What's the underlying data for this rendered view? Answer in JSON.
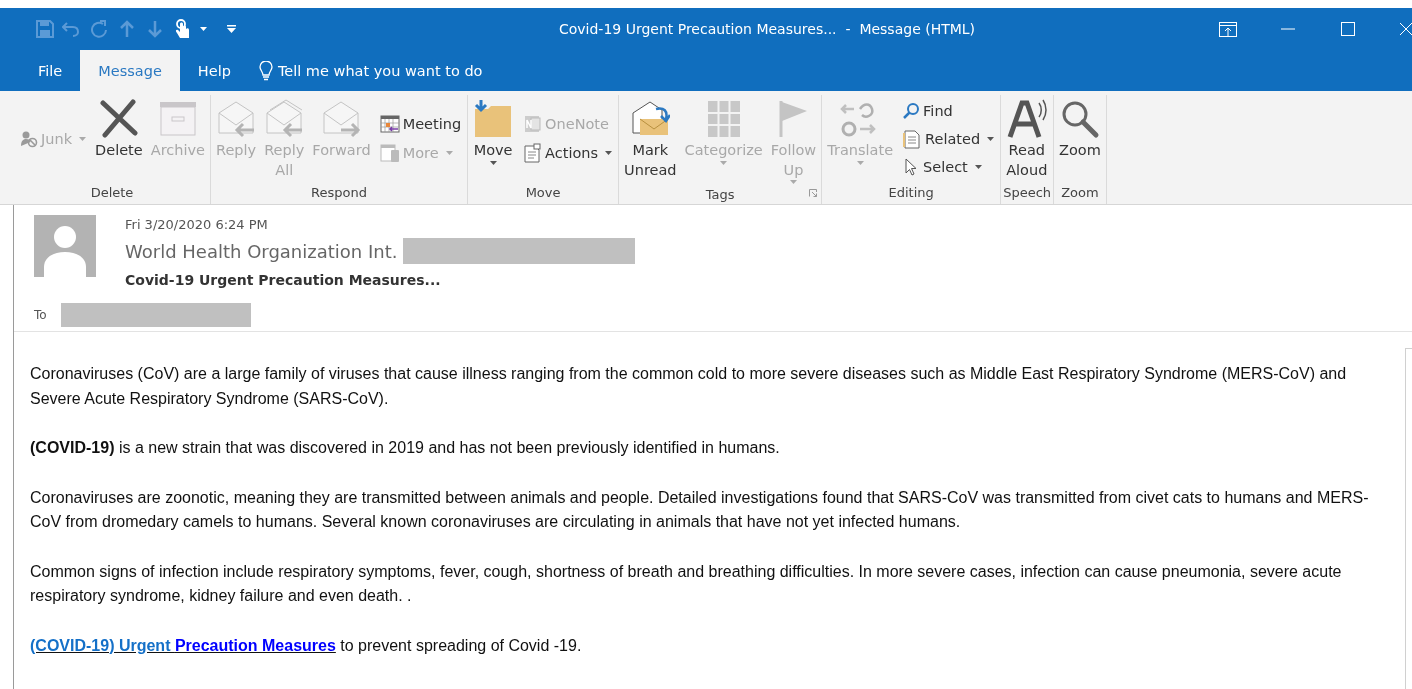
{
  "window": {
    "title": "Covid-19 Urgent Precaution Measures...  -  Message (HTML)"
  },
  "tabs": [
    {
      "label": "File",
      "selected": false
    },
    {
      "label": "Message",
      "selected": true
    },
    {
      "label": "Help",
      "selected": false
    }
  ],
  "tell_me": {
    "label": "Tell me what you want to do"
  },
  "ribbon": {
    "groups": [
      {
        "label": "Delete",
        "launcher": false,
        "items": [
          {
            "kind": "stack",
            "buttons": [
              {
                "label": "Junk",
                "disabled": true,
                "dropdown": true
              }
            ]
          },
          {
            "kind": "large",
            "label": "Delete",
            "disabled": false,
            "dropdown": false
          },
          {
            "kind": "large",
            "label": "Archive",
            "disabled": true,
            "dropdown": false
          }
        ]
      },
      {
        "label": "Respond",
        "launcher": false,
        "items": [
          {
            "kind": "large",
            "label": "Reply",
            "disabled": true,
            "dropdown": false
          },
          {
            "kind": "large",
            "label": "Reply All",
            "disabled": true,
            "dropdown": false
          },
          {
            "kind": "large",
            "label": "Forward",
            "disabled": true,
            "dropdown": false
          },
          {
            "kind": "stack",
            "buttons": [
              {
                "label": "Meeting",
                "disabled": false,
                "dropdown": false
              },
              {
                "label": "More",
                "disabled": true,
                "dropdown": true
              }
            ]
          }
        ]
      },
      {
        "label": "Move",
        "launcher": false,
        "items": [
          {
            "kind": "large",
            "label": "Move",
            "disabled": false,
            "dropdown": true
          },
          {
            "kind": "stack",
            "buttons": [
              {
                "label": "OneNote",
                "disabled": true,
                "dropdown": false
              },
              {
                "label": "Actions",
                "disabled": false,
                "dropdown": true
              }
            ]
          }
        ]
      },
      {
        "label": "Tags",
        "launcher": true,
        "items": [
          {
            "kind": "large",
            "label": "Mark Unread",
            "disabled": false,
            "dropdown": false
          },
          {
            "kind": "large",
            "label": "Categorize",
            "disabled": true,
            "dropdown": true
          },
          {
            "kind": "large",
            "label": "Follow Up",
            "disabled": true,
            "dropdown": true
          }
        ]
      },
      {
        "label": "Editing",
        "launcher": false,
        "items": [
          {
            "kind": "large",
            "label": "Translate",
            "disabled": true,
            "dropdown": true
          },
          {
            "kind": "stack",
            "buttons": [
              {
                "label": "Find",
                "disabled": false,
                "dropdown": false
              },
              {
                "label": "Related",
                "disabled": false,
                "dropdown": true
              },
              {
                "label": "Select",
                "disabled": false,
                "dropdown": true
              }
            ]
          }
        ]
      },
      {
        "label": "Speech",
        "launcher": false,
        "items": [
          {
            "kind": "large",
            "label": "Read Aloud",
            "disabled": false,
            "dropdown": false
          }
        ]
      },
      {
        "label": "Zoom",
        "launcher": false,
        "items": [
          {
            "kind": "large",
            "label": "Zoom",
            "disabled": false,
            "dropdown": false
          }
        ]
      }
    ]
  },
  "message": {
    "date": "Fri 3/20/2020 6:24 PM",
    "sender": "World Health Organization Int.",
    "subject": "Covid-19 Urgent Precaution Measures...",
    "to_label": "To"
  },
  "body": {
    "paragraphs": [
      "Coronaviruses (CoV) are a large family of viruses that cause illness ranging from the common cold to more severe diseases such as Middle East Respiratory Syndrome (MERS-CoV) and Severe Acute Respiratory Syndrome (SARS-CoV).",
      "**(COVID-19)** is a new strain that was discovered in 2019 and has not been previously identified in humans.",
      "Coronaviruses are zoonotic, meaning they are transmitted between animals and people.  Detailed investigations found that SARS-CoV was transmitted from civet cats to humans and MERS-CoV from dromedary camels to humans. Several known coronaviruses are circulating in animals that have not yet infected humans.",
      "Common signs of infection include respiratory symptoms, fever, cough, shortness of breath and breathing difficulties. In more severe cases, infection can cause pneumonia, severe acute respiratory syndrome, kidney failure and even death. ."
    ],
    "link": {
      "parts": [
        {
          "text": "(COVID-19) Urgent ",
          "color": "#1470c8"
        },
        {
          "text": "Precaution Measures",
          "color": "#0000ff"
        }
      ]
    },
    "link_tail": " to prevent spreading of Covid -19."
  }
}
